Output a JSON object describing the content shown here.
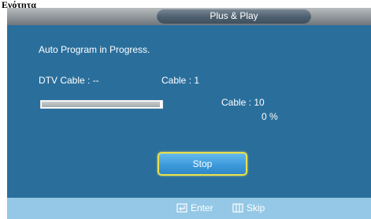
{
  "page_label": "Ενότητα",
  "osd": {
    "title": "Plus & Play",
    "status_text": "Auto Program in Progress.",
    "dtv_cable": "DTV Cable : --",
    "cable_label": "Cable : 1",
    "scan_channel": "Cable : 10",
    "percent_text": "0 %",
    "progress_fraction": 0.99,
    "stop_label": "Stop"
  },
  "hints": {
    "enter_label": "Enter",
    "enter_icon": "enter-icon",
    "skip_label": "Skip",
    "skip_icon": "skip-icon"
  },
  "colors": {
    "panel_bg": "#2a6f9c",
    "bottom_bar": "#94c8e6",
    "button_border": "#e9e14a",
    "button_fill": "#3d9bdb"
  }
}
